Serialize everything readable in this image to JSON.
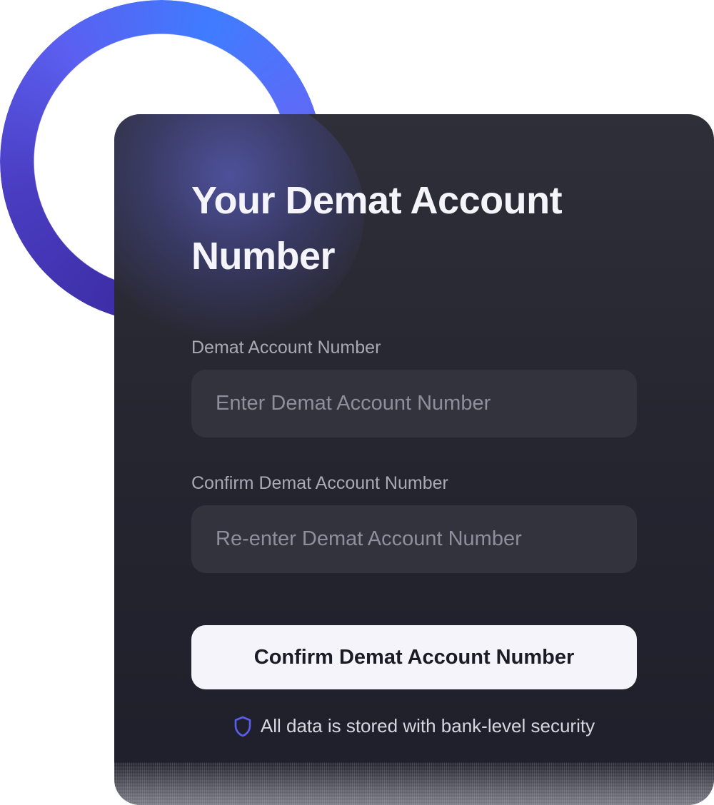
{
  "card": {
    "title": "Your Demat Account Number",
    "fields": [
      {
        "label": "Demat Account Number",
        "value": "",
        "placeholder": "Enter Demat Account Number"
      },
      {
        "label": "Confirm Demat Account Number",
        "value": "",
        "placeholder": "Re-enter Demat Account Number"
      }
    ],
    "submit_label": "Confirm Demat Account Number",
    "security_note": "All data is stored with bank-level security",
    "security_icon": "shield-icon"
  },
  "colors": {
    "ring_gradient": [
      "#3e2fa8",
      "#3f7cff",
      "#5d6bf7"
    ],
    "card_background": "#262631",
    "field_background": "#33333e",
    "button_background": "#f4f4fa",
    "shield_accent": "#5b5ff0"
  }
}
